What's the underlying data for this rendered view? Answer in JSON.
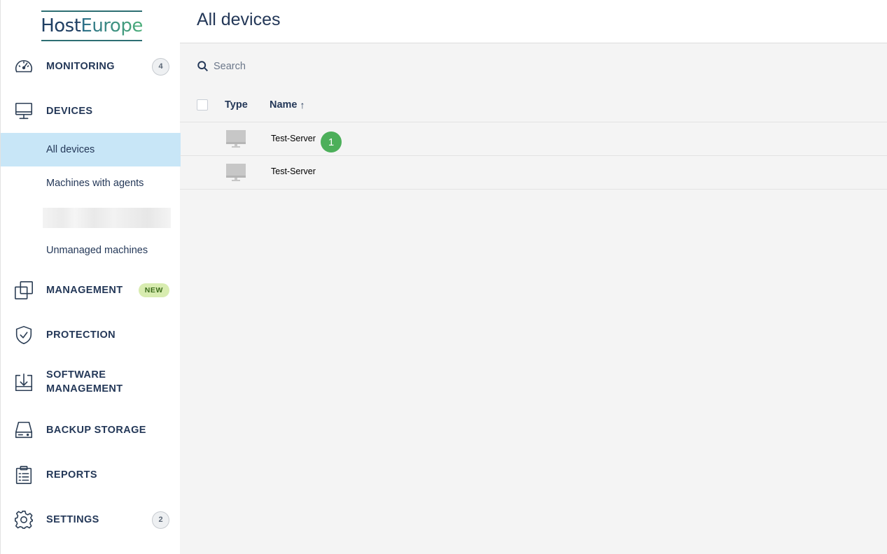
{
  "brand": {
    "host": "Host",
    "europe": "Europe"
  },
  "sidebar": {
    "monitoring": {
      "label": "MONITORING",
      "badge": "4"
    },
    "devices": {
      "label": "DEVICES",
      "items": [
        {
          "label": "All devices",
          "active": true
        },
        {
          "label": "Machines with agents"
        },
        {
          "label": "Unmanaged machines"
        }
      ]
    },
    "management": {
      "label": "MANAGEMENT",
      "badge": "NEW"
    },
    "protection": {
      "label": "PROTECTION"
    },
    "software": {
      "label_line1": "SOFTWARE",
      "label_line2": "MANAGEMENT"
    },
    "backup": {
      "label": "BACKUP STORAGE"
    },
    "reports": {
      "label": "REPORTS"
    },
    "settings": {
      "label": "SETTINGS",
      "badge": "2"
    }
  },
  "header": {
    "title": "All devices"
  },
  "search": {
    "placeholder": "Search"
  },
  "table": {
    "columns": {
      "type": "Type",
      "name": "Name",
      "sort_icon": "arrow-up-icon"
    },
    "rows": [
      {
        "type_icon": "monitor-icon",
        "name": "Test-Server"
      },
      {
        "type_icon": "monitor-icon",
        "name": "Test-Server"
      }
    ]
  },
  "annotation": {
    "step": "1"
  },
  "colors": {
    "active_bg": "#c8e6f7",
    "new_badge_bg": "#d8ecb0",
    "step_marker": "#4caf5a",
    "text": "#243858"
  }
}
